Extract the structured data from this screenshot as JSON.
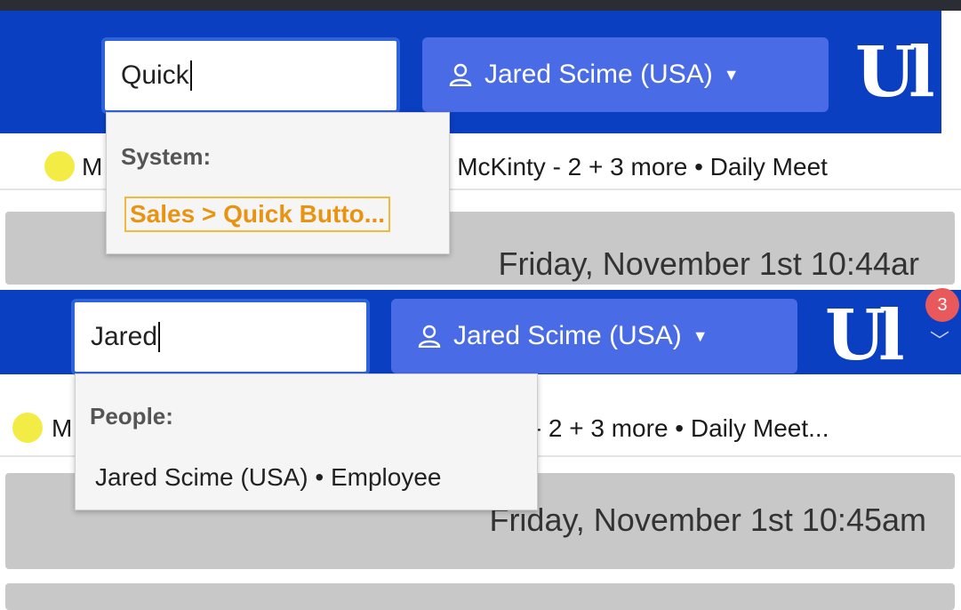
{
  "panels": [
    {
      "search": {
        "value": "Quick"
      },
      "user_button": {
        "label": "Jared Scime (USA)"
      },
      "ticker": {
        "lead": "M",
        "rest": "ll McKinty - 2 + 3 more • Daily Meet"
      },
      "datetime": "Friday, November 1st 10:44ar",
      "dropdown": {
        "heading": "System:",
        "results": [
          "Sales > Quick Butto..."
        ]
      }
    },
    {
      "search": {
        "value": "Jared"
      },
      "user_button": {
        "label": "Jared Scime (USA)"
      },
      "notification_count": "3",
      "ticker": {
        "lead": "M",
        "rest": "y - 2 + 3 more • Daily Meet..."
      },
      "datetime": "Friday, November 1st 10:45am",
      "dropdown": {
        "heading": "People:",
        "results": [
          "Jared Scime (USA) • Employee"
        ]
      }
    }
  ],
  "colors": {
    "topbar": "#0a3fc2",
    "user_button": "#4a6be6",
    "highlight_text": "#e89412",
    "status_dot": "#f2ec45",
    "badge": "#e9585a"
  },
  "icons": [
    "person-icon",
    "caret-down-icon",
    "app-logo",
    "chevron-down-icon"
  ]
}
